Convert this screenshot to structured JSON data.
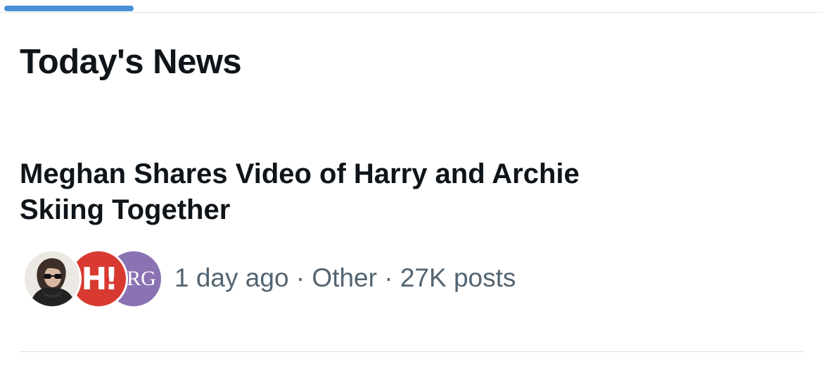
{
  "section": {
    "title": "Today's News"
  },
  "story": {
    "headline": "Meghan Shares Video of Harry and Archie Skiing Together",
    "time": "1 day ago",
    "category": "Other",
    "post_count": "27K posts",
    "separator": "·",
    "avatars": [
      {
        "name": "person-avatar",
        "color": "#e9e4df"
      },
      {
        "name": "hello-magazine-avatar",
        "text": "H!",
        "color": "#d83a31"
      },
      {
        "name": "rg-avatar",
        "text": "RG",
        "color": "#8a72b3"
      }
    ]
  },
  "colors": {
    "tab_indicator": "#4a90d9",
    "primary_text": "#0f1419",
    "secondary_text": "#536471"
  }
}
